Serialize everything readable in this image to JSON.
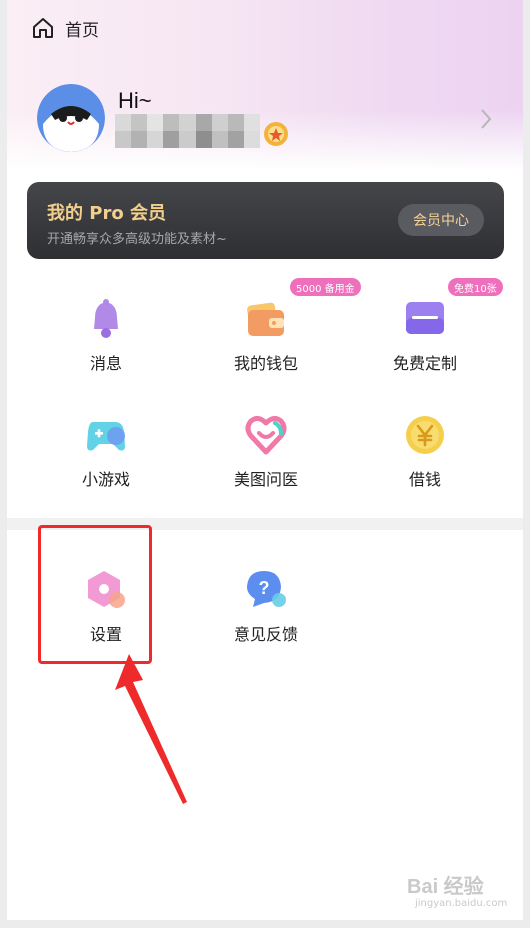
{
  "header": {
    "title": "首页",
    "home_icon": "home-icon"
  },
  "profile": {
    "greeting": "Hi~",
    "nickname_blurred": true,
    "medal_icon": "medal-icon"
  },
  "pro": {
    "title": "我的 Pro 会员",
    "subtitle": "开通畅享众多高级功能及素材~",
    "button": "会员中心"
  },
  "features": [
    {
      "label": "消息",
      "icon": "bell-icon"
    },
    {
      "label": "我的钱包",
      "icon": "wallet-icon",
      "badge": "5000 备用金"
    },
    {
      "label": "免费定制",
      "icon": "custom-card-icon",
      "badge": "免费10张"
    },
    {
      "label": "小游戏",
      "icon": "gamepad-icon"
    },
    {
      "label": "美图问医",
      "icon": "heart-icon"
    },
    {
      "label": "借钱",
      "icon": "yen-coin-icon"
    }
  ],
  "tools": [
    {
      "label": "设置",
      "icon": "settings-icon"
    },
    {
      "label": "意见反馈",
      "icon": "feedback-icon"
    }
  ],
  "annotation": {
    "highlight": "settings",
    "color": "#ee2a2a"
  },
  "watermark": {
    "main": "Bai 经验",
    "sub": "jingyan.baidu.com"
  }
}
